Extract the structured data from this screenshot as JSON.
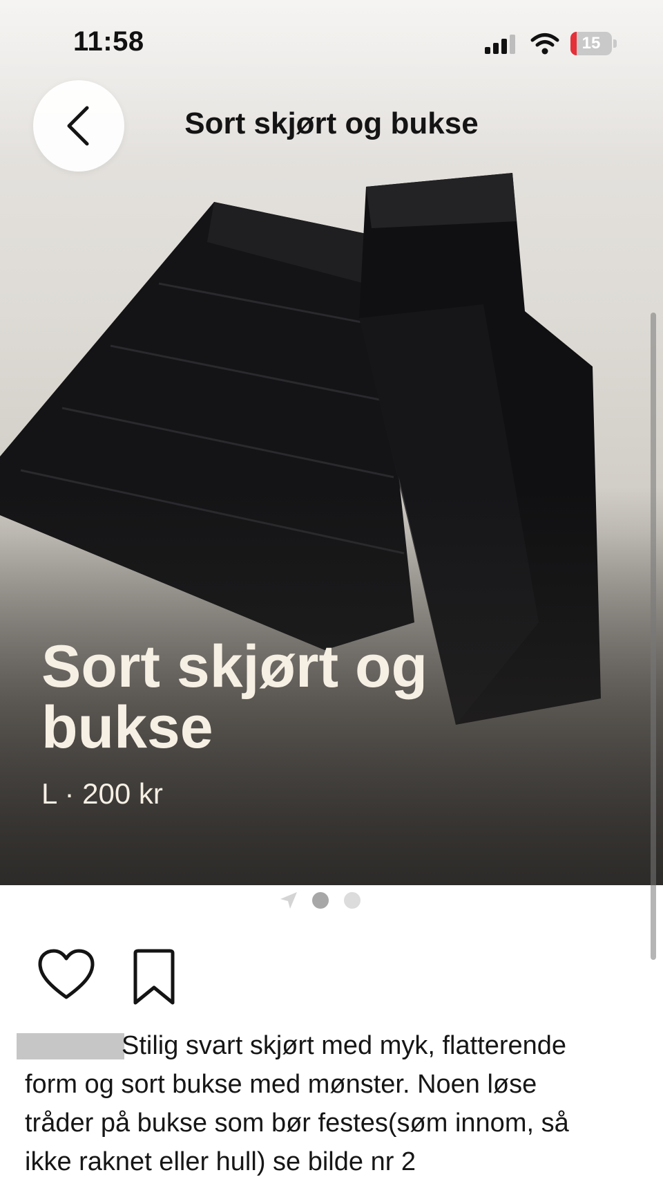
{
  "status_bar": {
    "time": "11:58",
    "battery_level": "15",
    "battery_percent": 15,
    "battery_color": "#e5303a"
  },
  "header": {
    "title": "Sort skjørt og bukse",
    "back_icon": "chevron-left-icon"
  },
  "listing": {
    "title": "Sort skjørt og bukse",
    "meta": "L · 200 kr"
  },
  "pager": {
    "total": 2,
    "current": 1
  },
  "actions": {
    "like_icon": "heart-icon",
    "save_icon": "bookmark-icon"
  },
  "description": {
    "text": "Stilig svart skjørt med myk, flatterende\nform og sort bukse med mønster. Noen løse\ntråder på bukse som bør festes(søm innom, så\nikke raknet eller hull) se bilde nr 2"
  }
}
